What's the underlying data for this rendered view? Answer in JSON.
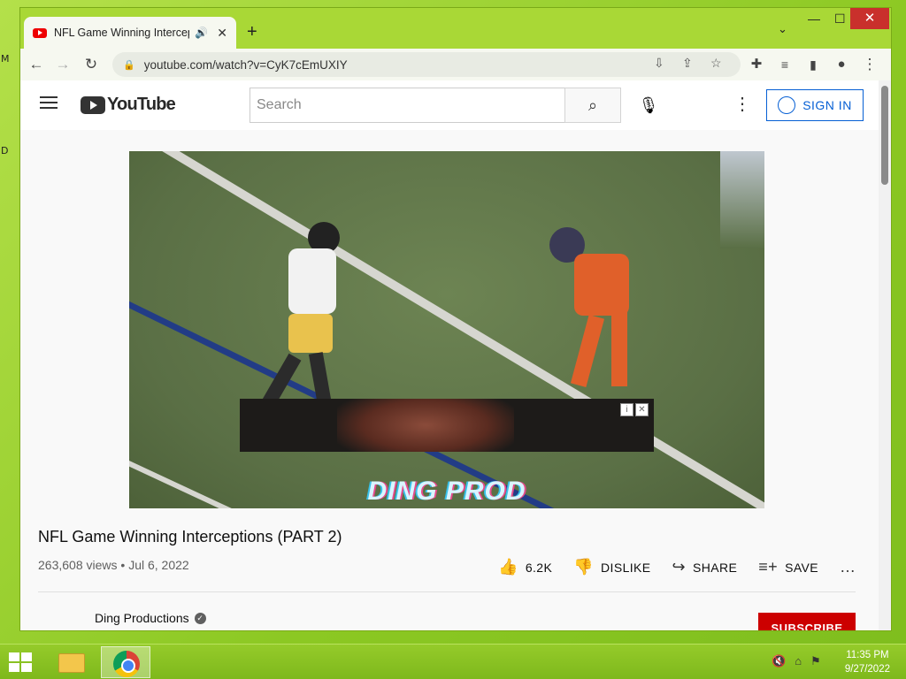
{
  "desktop": {
    "labels": [
      "M",
      "D"
    ]
  },
  "browser": {
    "tab": {
      "title": "NFL Game Winning Intercep",
      "audio_icon": "speaker-icon",
      "close_label": "✕"
    },
    "new_tab_label": "+",
    "tab_search_label": "⌄",
    "window_controls": {
      "minimize": "—",
      "maximize": "☐",
      "close": "✕"
    },
    "nav": {
      "back": "←",
      "forward": "→",
      "reload": "↻"
    },
    "omnibox": {
      "url": "youtube.com/watch?v=CyK7cEmUXIY"
    }
  },
  "youtube": {
    "logo_text": "YouTube",
    "search": {
      "placeholder": "Search"
    },
    "sign_in_label": "SIGN IN",
    "video": {
      "watermark": "DING PROD",
      "title": "NFL Game Winning Interceptions (PART 2)",
      "views": "263,608 views",
      "date": "Jul 6, 2022",
      "likes": "6.2K",
      "dislike_label": "DISLIKE",
      "share_label": "SHARE",
      "save_label": "SAVE",
      "more_label": "…"
    },
    "channel": {
      "name": "Ding Productions",
      "subscribe_label": "SUBSCRIBE"
    }
  },
  "taskbar": {
    "clock_time": "11:35 PM",
    "clock_date": "9/27/2022"
  },
  "colors": {
    "yt_red": "#cc0000",
    "link_blue": "#065fd4",
    "desktop_green": "#8cc823"
  }
}
